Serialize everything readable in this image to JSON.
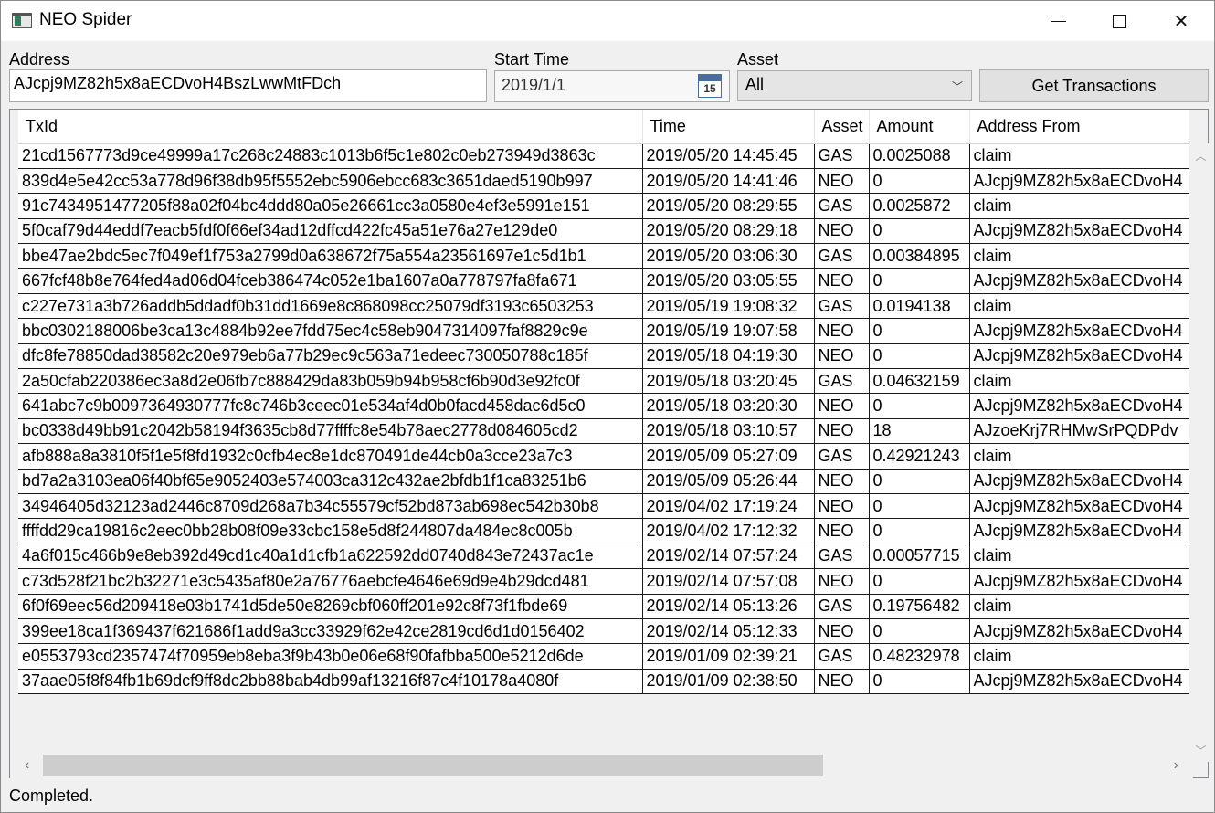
{
  "window": {
    "title": "NEO Spider"
  },
  "form": {
    "address_label": "Address",
    "address_value": "AJcpj9MZ82h5x8aECDvoH4BszLwwMtFDch",
    "start_time_label": "Start Time",
    "start_time_value": "2019/1/1",
    "calendar_day": "15",
    "asset_label": "Asset",
    "asset_value": "All",
    "get_button_label": "Get Transactions"
  },
  "table": {
    "columns": [
      "TxId",
      "Time",
      "Asset",
      "Amount",
      "Address From"
    ],
    "rows": [
      [
        "21cd1567773d9ce49999a17c268c24883c1013b6f5c1e802c0eb273949d3863c",
        "2019/05/20 14:45:45",
        "GAS",
        "0.0025088",
        "claim"
      ],
      [
        "839d4e5e42cc53a778d96f38db95f5552ebc5906ebcc683c3651daed5190b997",
        "2019/05/20 14:41:46",
        "NEO",
        "0",
        "AJcpj9MZ82h5x8aECDvoH4"
      ],
      [
        "91c7434951477205f88a02f04bc4ddd80a05e26661cc3a0580e4ef3e5991e151",
        "2019/05/20 08:29:55",
        "GAS",
        "0.0025872",
        "claim"
      ],
      [
        "5f0caf79d44eddf7eacb5fdf0f66ef34ad12dffcd422fc45a51e76a27e129de0",
        "2019/05/20 08:29:18",
        "NEO",
        "0",
        "AJcpj9MZ82h5x8aECDvoH4"
      ],
      [
        "bbe47ae2bdc5ec7f049ef1f753a2799d0a638672f75a554a23561697e1c5d1b1",
        "2019/05/20 03:06:30",
        "GAS",
        "0.00384895",
        "claim"
      ],
      [
        "667fcf48b8e764fed4ad06d04fceb386474c052e1ba1607a0a778797fa8fa671",
        "2019/05/20 03:05:55",
        "NEO",
        "0",
        "AJcpj9MZ82h5x8aECDvoH4"
      ],
      [
        "c227e731a3b726addb5ddadf0b31dd1669e8c868098cc25079df3193c6503253",
        "2019/05/19 19:08:32",
        "GAS",
        "0.0194138",
        "claim"
      ],
      [
        "bbc0302188006be3ca13c4884b92ee7fdd75ec4c58eb9047314097faf8829c9e",
        "2019/05/19 19:07:58",
        "NEO",
        "0",
        "AJcpj9MZ82h5x8aECDvoH4"
      ],
      [
        "dfc8fe78850dad38582c20e979eb6a77b29ec9c563a71edeec730050788c185f",
        "2019/05/18 04:19:30",
        "NEO",
        "0",
        "AJcpj9MZ82h5x8aECDvoH4"
      ],
      [
        "2a50cfab220386ec3a8d2e06fb7c888429da83b059b94b958cf6b90d3e92fc0f",
        "2019/05/18 03:20:45",
        "GAS",
        "0.04632159",
        "claim"
      ],
      [
        "641abc7c9b0097364930777fc8c746b3ceec01e534af4d0b0facd458dac6d5c0",
        "2019/05/18 03:20:30",
        "NEO",
        "0",
        "AJcpj9MZ82h5x8aECDvoH4"
      ],
      [
        "bc0338d49bb91c2042b58194f3635cb8d77ffffc8e54b78aec2778d084605cd2",
        "2019/05/18 03:10:57",
        "NEO",
        "18",
        "AJzoeKrj7RHMwSrPQDPdv"
      ],
      [
        "afb888a8a3810f5f1e5f8fd1932c0cfb4ec8e1dc870491de44cb0a3cce23a7c3",
        "2019/05/09 05:27:09",
        "GAS",
        "0.42921243",
        "claim"
      ],
      [
        "bd7a2a3103ea06f40bf65e9052403e574003ca312c432ae2bfdb1f1ca83251b6",
        "2019/05/09 05:26:44",
        "NEO",
        "0",
        "AJcpj9MZ82h5x8aECDvoH4"
      ],
      [
        "34946405d32123ad2446c8709d268a7b34c55579cf52bd873ab698ec542b30b8",
        "2019/04/02 17:19:24",
        "NEO",
        "0",
        "AJcpj9MZ82h5x8aECDvoH4"
      ],
      [
        "ffffdd29ca19816c2eec0bb28b08f09e33cbc158e5d8f244807da484ec8c005b",
        "2019/04/02 17:12:32",
        "NEO",
        "0",
        "AJcpj9MZ82h5x8aECDvoH4"
      ],
      [
        "4a6f015c466b9e8eb392d49cd1c40a1d1cfb1a622592dd0740d843e72437ac1e",
        "2019/02/14 07:57:24",
        "GAS",
        "0.00057715",
        "claim"
      ],
      [
        "c73d528f21bc2b32271e3c5435af80e2a76776aebcfe4646e69d9e4b29dcd481",
        "2019/02/14 07:57:08",
        "NEO",
        "0",
        "AJcpj9MZ82h5x8aECDvoH4"
      ],
      [
        "6f0f69eec56d209418e03b1741d5de50e8269cbf060ff201e92c8f73f1fbde69",
        "2019/02/14 05:13:26",
        "GAS",
        "0.19756482",
        "claim"
      ],
      [
        "399ee18ca1f369437f621686f1add9a3cc33929f62e42ce2819cd6d1d0156402",
        "2019/02/14 05:12:33",
        "NEO",
        "0",
        "AJcpj9MZ82h5x8aECDvoH4"
      ],
      [
        "e0553793cd2357474f70959eb8eba3f9b43b0e06e68f90fafbba500e5212d6de",
        "2019/01/09 02:39:21",
        "GAS",
        "0.48232978",
        "claim"
      ],
      [
        "37aae05f8f84fb1b69dcf9ff8dc2bb88bab4db99af13216f87c4f10178a4080f",
        "2019/01/09 02:38:50",
        "NEO",
        "0",
        "AJcpj9MZ82h5x8aECDvoH4"
      ]
    ]
  },
  "horizontal_scroll_fraction": 0.67,
  "status": "Completed."
}
